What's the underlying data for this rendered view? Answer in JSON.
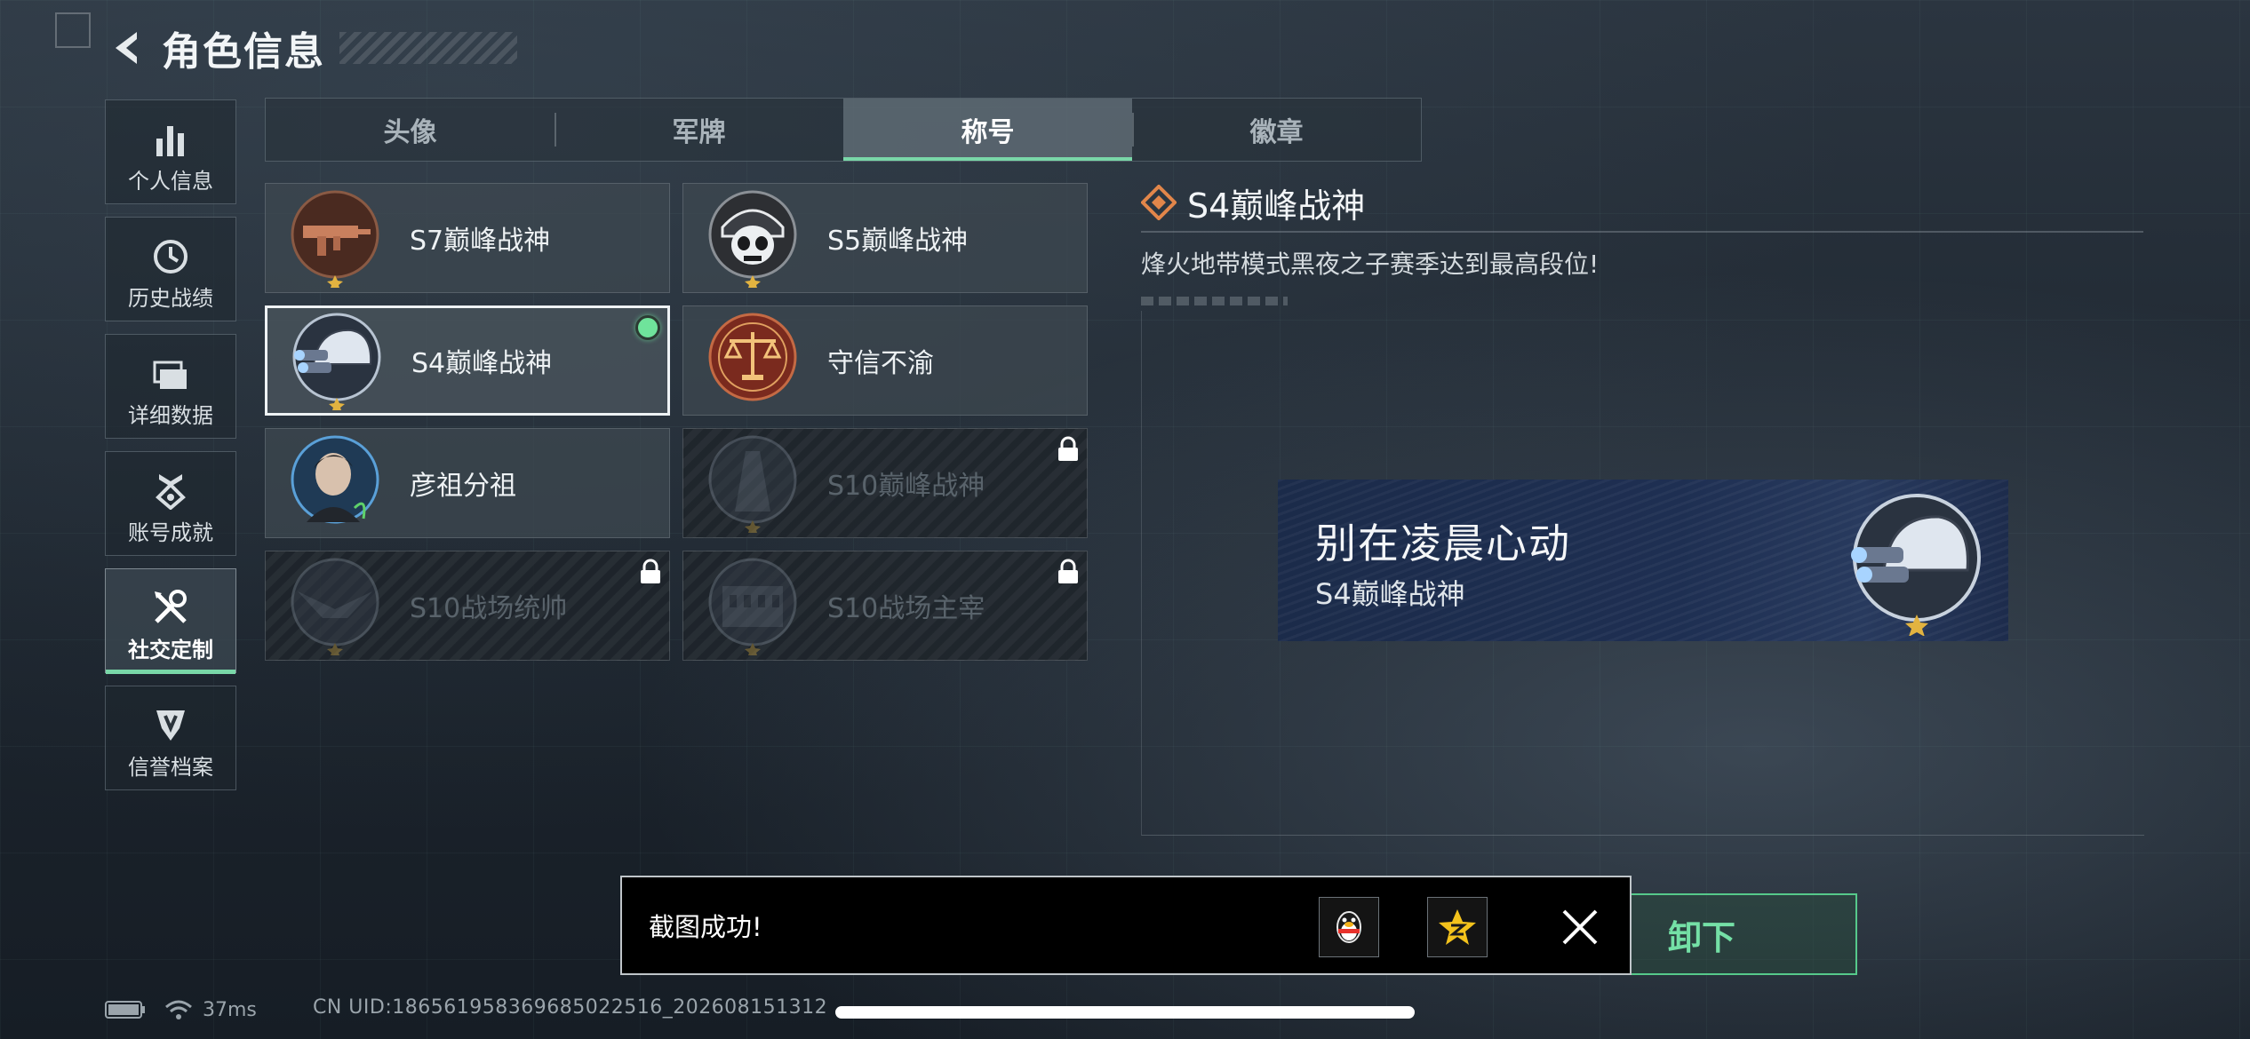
{
  "header": {
    "title": "角色信息"
  },
  "sidebar": {
    "items": [
      {
        "label": "个人信息",
        "icon": "bar-chart-icon"
      },
      {
        "label": "历史战绩",
        "icon": "history-clock-icon"
      },
      {
        "label": "详细数据",
        "icon": "folder-icon"
      },
      {
        "label": "账号成就",
        "icon": "achievement-icon"
      },
      {
        "label": "社交定制",
        "icon": "tools-icon",
        "active": true
      },
      {
        "label": "信誉档案",
        "icon": "credit-shield-icon"
      }
    ]
  },
  "tabs": [
    {
      "label": "头像"
    },
    {
      "label": "军牌"
    },
    {
      "label": "称号",
      "active": true
    },
    {
      "label": "徽章"
    }
  ],
  "titles": [
    {
      "name": "S7巅峰战神",
      "badge": "rifle-badge-icon"
    },
    {
      "name": "S5巅峰战神",
      "badge": "skull-helmet-badge-icon"
    },
    {
      "name": "S4巅峰战神",
      "badge": "nightvision-helmet-badge-icon",
      "selected": true,
      "equipped": true
    },
    {
      "name": "守信不渝",
      "badge": "scales-badge-icon"
    },
    {
      "name": "彦祖分祖",
      "badge": "portrait-badge-icon"
    },
    {
      "name": "S10巅峰战神",
      "badge": "tower-badge-icon",
      "locked": true
    },
    {
      "name": "S10战场统帅",
      "badge": "eagle-badge-icon",
      "locked": true
    },
    {
      "name": "S10战场主宰",
      "badge": "colosseum-badge-icon",
      "locked": true
    }
  ],
  "detail": {
    "title": "S4巅峰战神",
    "description": "烽火地带模式黑夜之子赛季达到最高段位!"
  },
  "preview": {
    "player_name": "别在凌晨心动",
    "title": "S4巅峰战神"
  },
  "action_button": {
    "label": "卸下"
  },
  "toast": {
    "message": "截图成功!",
    "share_targets": [
      "qq-penguin-icon",
      "qzone-star-icon"
    ]
  },
  "status": {
    "ping": "37ms",
    "uid": "CN UID:186561958369685022516_202608151312"
  },
  "colors": {
    "accent_green": "#79d7a8",
    "equipped_dot": "#6fe39b",
    "banner_blue": "#1e2f52"
  }
}
